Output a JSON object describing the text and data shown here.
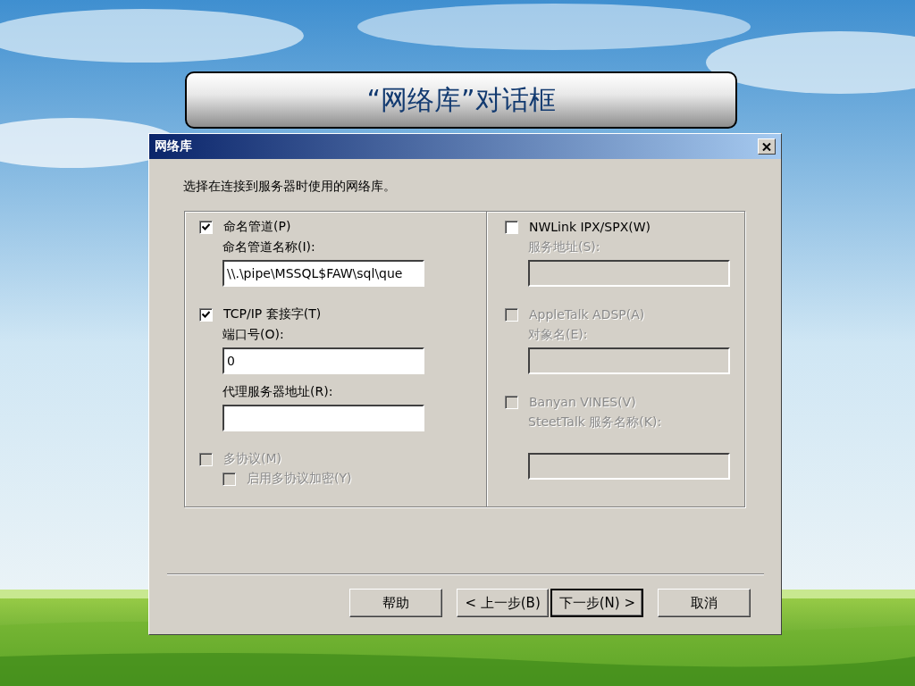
{
  "slide_title": "“网络库”对话框",
  "dialog": {
    "title": "网络库",
    "instruction": "选择在连接到服务器时使用的网络库。",
    "left_options": [
      {
        "label": "命名管道(P)",
        "checked": true,
        "disabled": false,
        "fields": [
          {
            "label": "命名管道名称(I):",
            "value": "\\\\.\\pipe\\MSSQL$FAW\\sql\\que",
            "disabled": false
          }
        ]
      },
      {
        "label": "TCP/IP 套接字(T)",
        "checked": true,
        "disabled": false,
        "fields": [
          {
            "label": "端口号(O):",
            "value": "0",
            "disabled": false
          },
          {
            "label": "代理服务器地址(R):",
            "disabled": false
          }
        ]
      },
      {
        "label": "多协议(M)",
        "checked": false,
        "disabled": true,
        "children": [
          {
            "label": "启用多协议加密(Y)",
            "checked": false,
            "disabled": true
          }
        ]
      }
    ],
    "right_options": [
      {
        "label": "NWLink IPX/SPX(W)",
        "checked": false,
        "disabled": false,
        "fields": [
          {
            "label": "服务地址(S):",
            "disabled": true
          }
        ]
      },
      {
        "label": "AppleTalk ADSP(A)",
        "checked": false,
        "disabled": true,
        "fields": [
          {
            "label": "对象名(E):",
            "disabled": true
          }
        ]
      },
      {
        "label": "Banyan VINES(V)",
        "checked": false,
        "disabled": true,
        "fields": [
          {
            "label": "SteetTalk 服务名称(K):",
            "disabled": true
          }
        ]
      }
    ],
    "buttons": [
      {
        "label": "帮助",
        "default": false
      },
      {
        "label": "< 上一步(B)",
        "default": false
      },
      {
        "label": "下一步(N) >",
        "default": true
      },
      {
        "label": "取消",
        "default": false
      }
    ]
  }
}
